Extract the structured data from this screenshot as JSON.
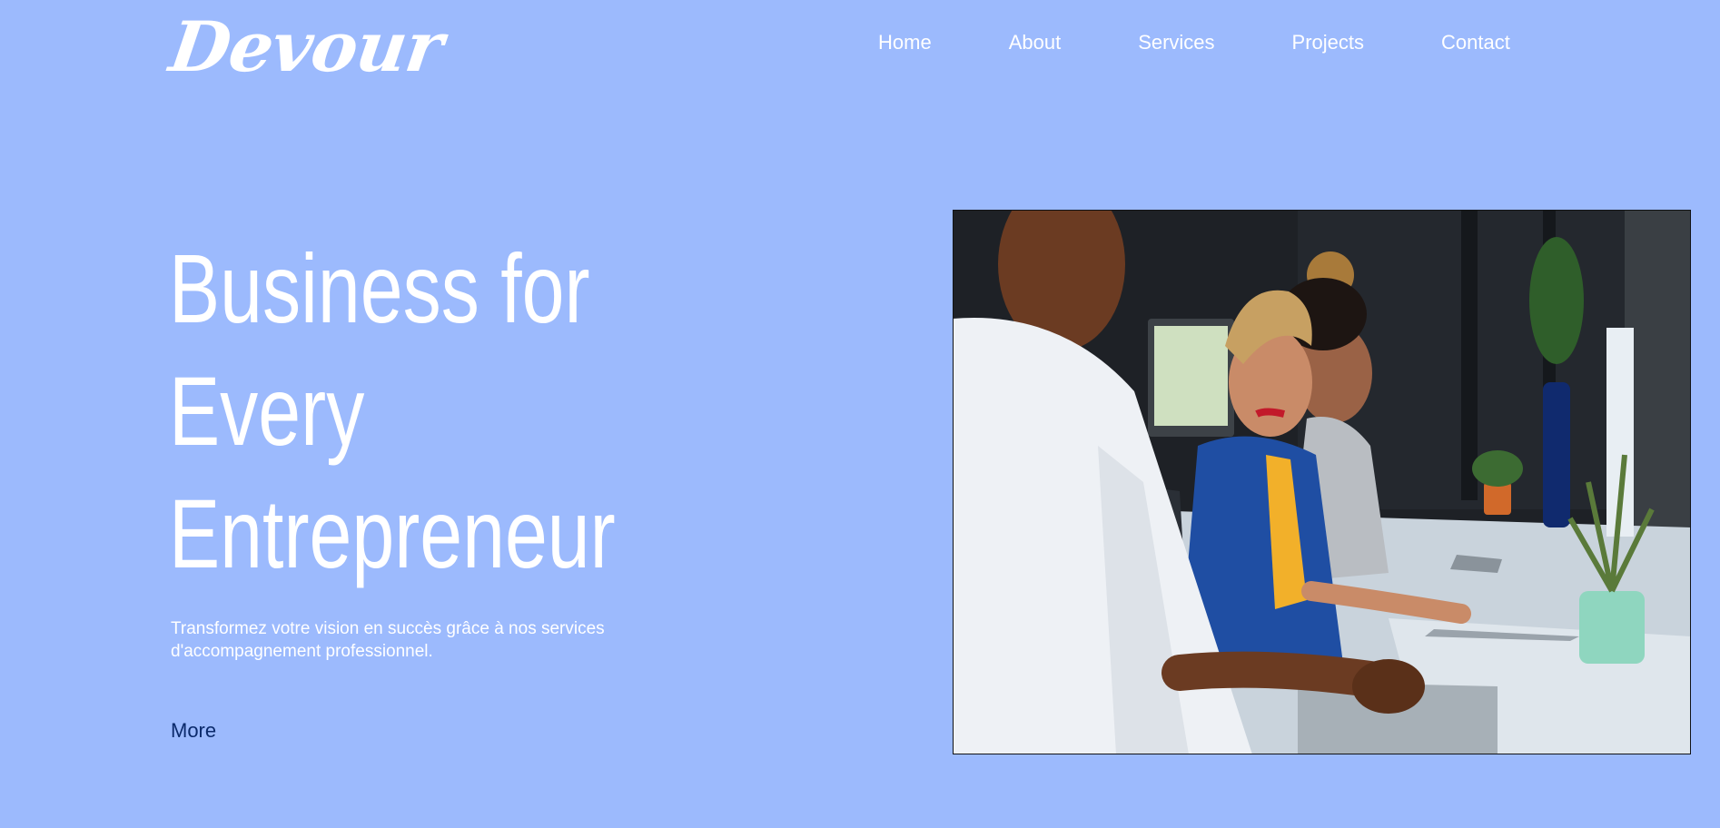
{
  "header": {
    "logo": "Devour",
    "nav": {
      "home": "Home",
      "about": "About",
      "services": "Services",
      "projects": "Projects",
      "contact": "Contact"
    }
  },
  "hero": {
    "title_lines": [
      "Business for",
      "Every",
      "Entrepreneur"
    ],
    "subtitle": "Transformez votre vision en succès grâce à nos services d'accompagnement professionnel.",
    "more_label": "More"
  },
  "colors": {
    "background": "#9cbafd",
    "text": "#ffffff",
    "link": "#0b2a6b"
  }
}
